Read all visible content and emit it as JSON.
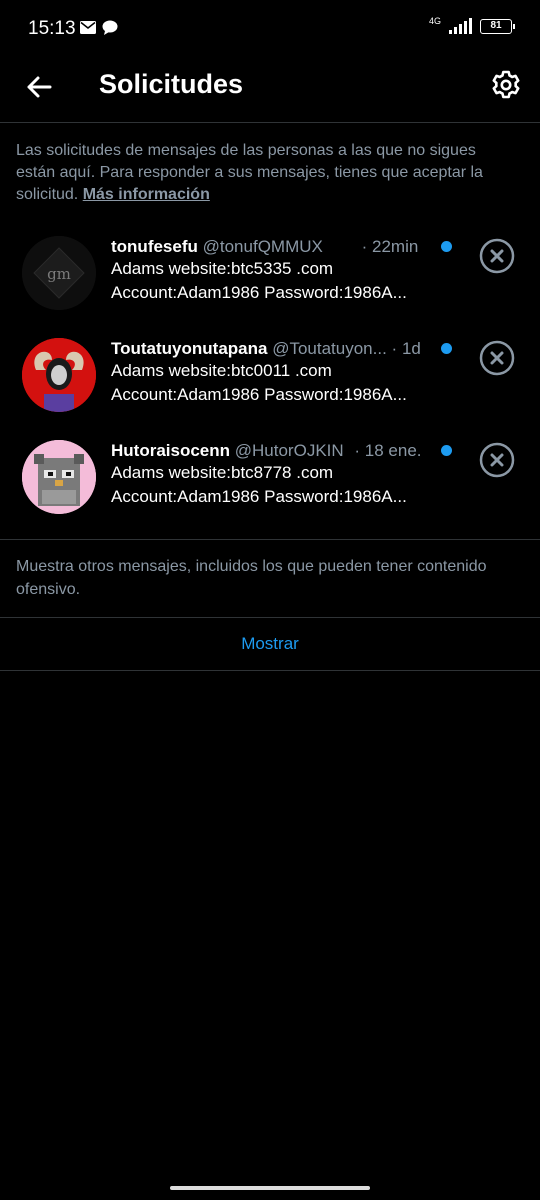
{
  "status_bar": {
    "time": "15:13",
    "network": "4G",
    "battery": "81"
  },
  "header": {
    "title": "Solicitudes"
  },
  "intro": {
    "text": "Las solicitudes de mensajes de las personas a las que no sigues están aquí. Para responder a sus mensajes, tienes que aceptar la solicitud. ",
    "link": "Más información"
  },
  "requests": [
    {
      "name": "tonufesefu",
      "handle": "@tonufQMMUX",
      "separator": "·",
      "time": "22min",
      "line1": "Adams website:btc5335 .com",
      "line2": "Account:Adam1986 Password:1986A..."
    },
    {
      "name": "Toutatuyonutapana",
      "handle": "@Toutatuyon...",
      "separator": "·",
      "time": "1d",
      "line1": "Adams website:btc0011 .com",
      "line2": "Account:Adam1986 Password:1986A..."
    },
    {
      "name": "Hutoraisocenn",
      "handle": "@HutorOJKIN",
      "separator": "·",
      "time": "18 ene.",
      "line1": "Adams website:btc8778 .com",
      "line2": "Account:Adam1986 Password:1986A..."
    }
  ],
  "other": {
    "text": "Muestra otros mensajes, incluidos los que pueden tener contenido ofensivo.",
    "button": "Mostrar"
  },
  "colors": {
    "accent": "#1d9bf0",
    "background": "#000000",
    "muted": "#8b98a5"
  }
}
